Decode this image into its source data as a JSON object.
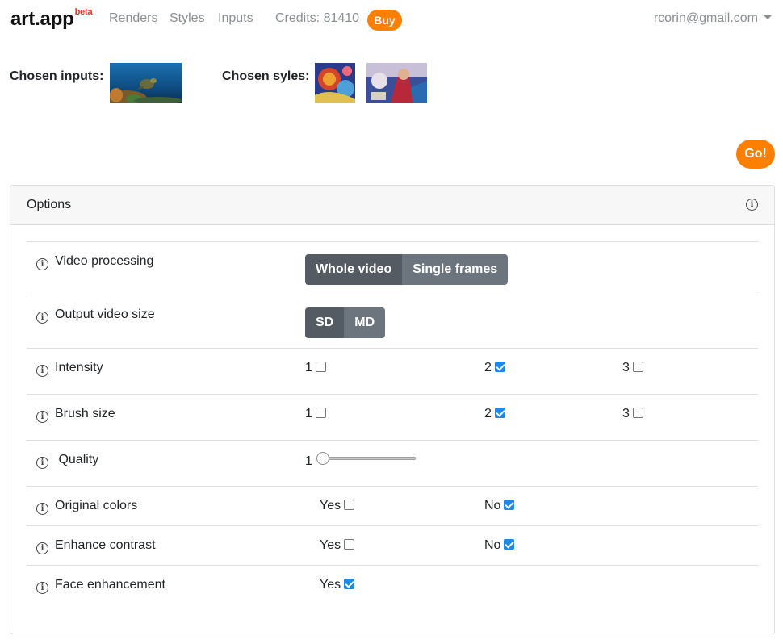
{
  "nav": {
    "brand": "art.app",
    "brand_badge": "beta",
    "links": [
      "Renders",
      "Styles",
      "Inputs"
    ],
    "credits": "Credits: 81410",
    "buy_label": "Buy",
    "user_email": "rcorin@gmail.com"
  },
  "chosen": {
    "inputs_label": "Chosen inputs:",
    "styles_label": "Chosen syles:"
  },
  "go_label": "Go!",
  "options": {
    "title": "Options",
    "rows": {
      "video_processing": {
        "label": "Video processing",
        "options": [
          "Whole video",
          "Single frames"
        ],
        "selected": "Whole video"
      },
      "output_size": {
        "label": "Output video size",
        "options": [
          "SD",
          "MD"
        ],
        "selected": "SD"
      },
      "intensity": {
        "label": "Intensity",
        "choices": [
          "1",
          "2",
          "3"
        ],
        "checked": "2"
      },
      "brush_size": {
        "label": "Brush size",
        "choices": [
          "1",
          "2",
          "3"
        ],
        "checked": "2"
      },
      "quality": {
        "label": "Quality",
        "value": "1"
      },
      "original_colors": {
        "label": "Original colors",
        "yes": "Yes",
        "no": "No",
        "checked": "No"
      },
      "enhance_contrast": {
        "label": "Enhance contrast",
        "yes": "Yes",
        "no": "No",
        "checked": "No"
      },
      "face_enhancement": {
        "label": "Face enhancement",
        "yes": "Yes",
        "checked": "Yes"
      }
    }
  },
  "colors": {
    "accent": "#ff7f00",
    "brand_badge": "#e8352b",
    "checkbox_checked": "#1e88e5",
    "segment_active": "#545b62",
    "segment_inactive": "#6c757d"
  }
}
